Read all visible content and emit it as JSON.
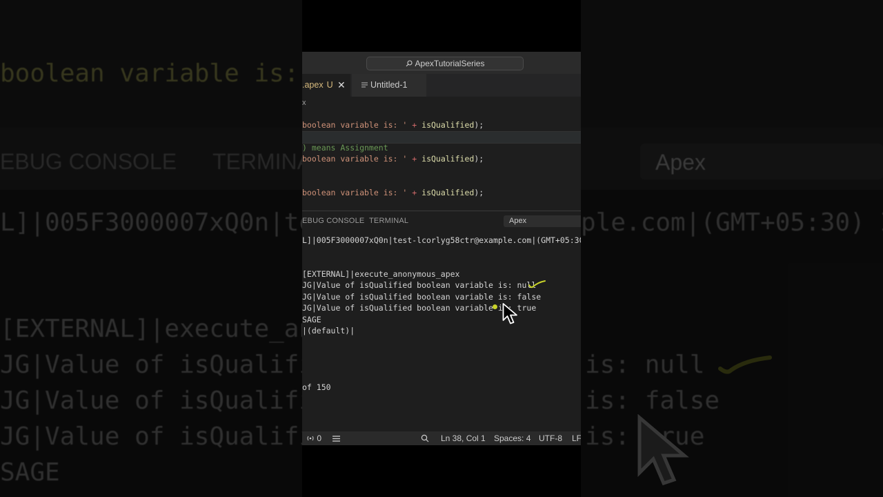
{
  "window": {
    "search_label": "ApexTutorialSeries"
  },
  "tabs": [
    {
      "label": ".apex",
      "status": "U",
      "close": "✕"
    },
    {
      "label": "Untitled-1"
    }
  ],
  "breadcrumb": "x",
  "code_lines": [
    {
      "pre": "boolean variable is: '",
      "plus": "+",
      "id": "isQualified",
      "post": ");"
    },
    {
      "comment": ") means Assignment"
    },
    {
      "pre": "boolean variable is: '",
      "plus": "+",
      "id": "isQualified",
      "post": ");"
    },
    {
      "pre": "boolean variable is: '",
      "plus": "+",
      "id": "isQualified",
      "post": ");"
    }
  ],
  "panel": {
    "tabs": [
      "EBUG CONSOLE",
      "TERMINAL"
    ],
    "language_select": "Apex"
  },
  "output_lines": [
    "L]|005F3000007xQ0n|test-lcorlyg58ctr@example.com|(GMT+05:30) I",
    "[EXTERNAL]|execute_anonymous_apex",
    "JG|Value of isQualified boolean variable is: null",
    "JG|Value of isQualified boolean variable is: false",
    "JG|Value of isQualified boolean variable is: true",
    "SAGE",
    "|(default)|",
    "of 150"
  ],
  "statusbar": {
    "ports": "0",
    "position": "Ln 38, Col 1",
    "spaces": "Spaces: 4",
    "encoding": "UTF-8",
    "eol": "LF"
  },
  "background": {
    "line1": "boolean variable is:",
    "tab_debug": "EBUG CONSOLE",
    "tab_terminal": "TERMINA",
    "apex": "Apex",
    "out1": "L]|005F3000007xQ0n|te",
    "out1b": "ple.com|(GMT+05:30) I",
    "out2": "[EXTERNAL]|execute_an",
    "out3a": "JG|Value of isQualifie",
    "out3b": "is: null",
    "out4a": "JG|Value of isQualifie",
    "out4b": "is: false",
    "out5a": "JG|Value of isQualifie",
    "out5b": "is: true",
    "out6": "SAGE"
  },
  "colors": {
    "annotation": "#c8d22a",
    "modified_tab": "#d7ba7d"
  }
}
